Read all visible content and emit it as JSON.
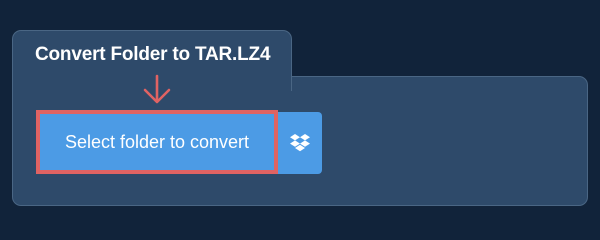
{
  "card": {
    "title": "Convert Folder to TAR.LZ4"
  },
  "actions": {
    "select_folder_label": "Select folder to convert",
    "dropbox_icon": "dropbox-icon",
    "pointer_icon": "arrow-down-icon"
  },
  "colors": {
    "page_background": "#11233a",
    "card_background": "#2e4a6a",
    "button_blue": "#4c9be5",
    "highlight_red": "#e06363"
  }
}
